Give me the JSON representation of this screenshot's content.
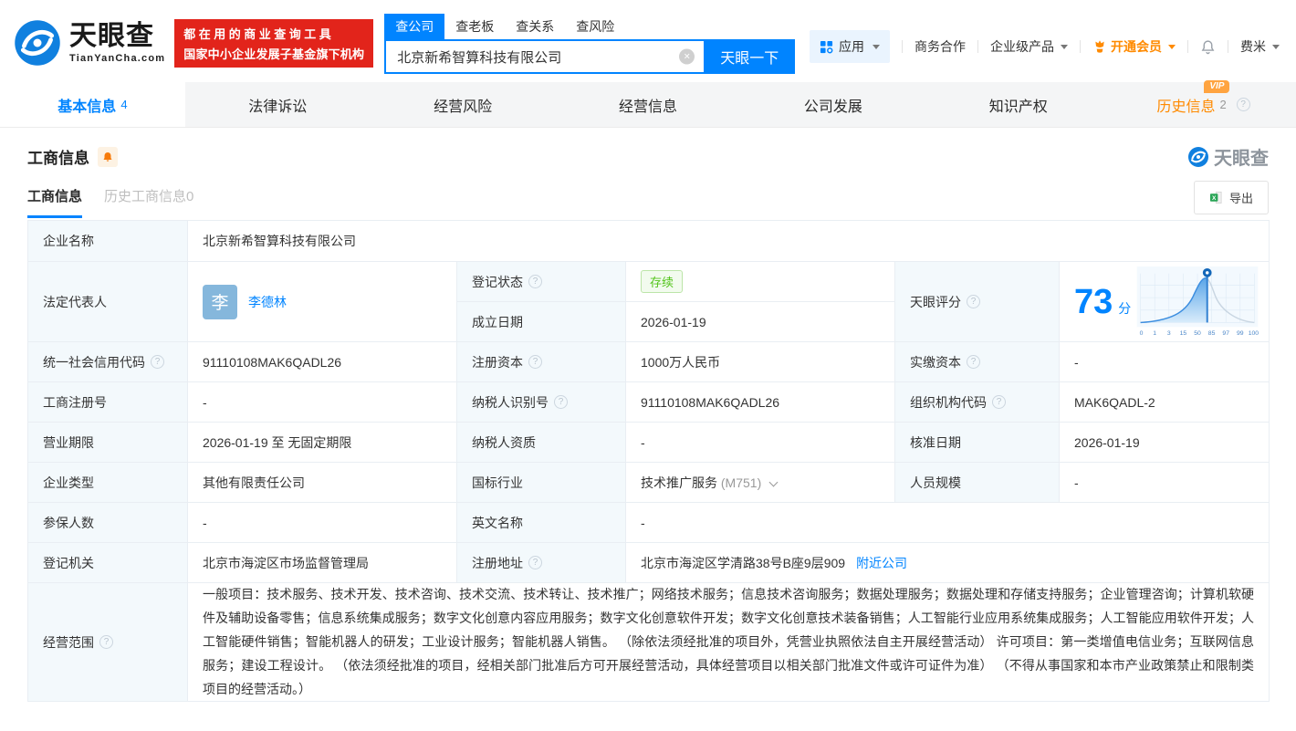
{
  "colors": {
    "accent": "#0084ff",
    "orange": "#ff8a00",
    "red": "#e2241b",
    "green": "#52c41a"
  },
  "header": {
    "brand": "天眼查",
    "brand_domain": "TianYanCha.com",
    "slogan_line1": "都在用的商业查询工具",
    "slogan_line2": "国家中小企业发展子基金旗下机构",
    "search_tabs": [
      "查公司",
      "查老板",
      "查关系",
      "查风险"
    ],
    "search_value": "北京新希智算科技有限公司",
    "search_button": "天眼一下",
    "menu_apps": "应用",
    "menu_cooperation": "商务合作",
    "menu_enterprise": "企业级产品",
    "menu_vip": "开通会员",
    "menu_user": "费米"
  },
  "nav": [
    {
      "label": "基本信息",
      "count": "4"
    },
    {
      "label": "法律诉讼"
    },
    {
      "label": "经营风险"
    },
    {
      "label": "经营信息"
    },
    {
      "label": "公司发展"
    },
    {
      "label": "知识产权"
    },
    {
      "label": "历史信息",
      "count": "2",
      "vip": "VIP"
    }
  ],
  "section": {
    "title": "工商信息",
    "watermark": "天眼查",
    "tab_current": "工商信息",
    "tab_history": "历史工商信息0",
    "export_label": "导出"
  },
  "table": {
    "company_name": {
      "label": "企业名称",
      "value": "北京新希智算科技有限公司"
    },
    "legal_rep": {
      "label": "法定代表人",
      "avatar": "李",
      "value": "李德林"
    },
    "reg_status": {
      "label": "登记状态",
      "value": "存续"
    },
    "establish_date": {
      "label": "成立日期",
      "value": "2026-01-19"
    },
    "score": {
      "label": "天眼评分",
      "value": "73",
      "unit": "分",
      "axis": [
        "0",
        "1",
        "3",
        "15",
        "50",
        "85",
        "97",
        "99",
        "100"
      ]
    },
    "credit_code": {
      "label": "统一社会信用代码",
      "value": "91110108MAK6QADL26"
    },
    "reg_capital": {
      "label": "注册资本",
      "value": "1000万人民币"
    },
    "paid_capital": {
      "label": "实缴资本",
      "value": "-"
    },
    "reg_number": {
      "label": "工商注册号",
      "value": "-"
    },
    "taxpayer_id": {
      "label": "纳税人识别号",
      "value": "91110108MAK6QADL26"
    },
    "org_code": {
      "label": "组织机构代码",
      "value": "MAK6QADL-2"
    },
    "business_term": {
      "label": "营业期限",
      "value": "2026-01-19 至 无固定期限"
    },
    "taxpayer_quality": {
      "label": "纳税人资质",
      "value": "-"
    },
    "approval_date": {
      "label": "核准日期",
      "value": "2026-01-19"
    },
    "company_type": {
      "label": "企业类型",
      "value": "其他有限责任公司"
    },
    "industry": {
      "label": "国标行业",
      "value": "技术推广服务",
      "code": "(M751)"
    },
    "staff_size": {
      "label": "人员规模",
      "value": "-"
    },
    "insured_count": {
      "label": "参保人数",
      "value": "-"
    },
    "english_name": {
      "label": "英文名称",
      "value": "-"
    },
    "reg_authority": {
      "label": "登记机关",
      "value": "北京市海淀区市场监督管理局"
    },
    "reg_address": {
      "label": "注册地址",
      "value": "北京市海淀区学清路38号B座9层909",
      "nearby_link": "附近公司"
    },
    "business_scope": {
      "label": "经营范围",
      "value": "一般项目：技术服务、技术开发、技术咨询、技术交流、技术转让、技术推广；网络技术服务；信息技术咨询服务；数据处理服务；数据处理和存储支持服务；企业管理咨询；计算机软硬件及辅助设备零售；信息系统集成服务；数字文化创意内容应用服务；数字文化创意软件开发；数字文化创意技术装备销售；人工智能行业应用系统集成服务；人工智能应用软件开发；人工智能硬件销售；智能机器人的研发；工业设计服务；智能机器人销售。 （除依法须经批准的项目外，凭营业执照依法自主开展经营活动） 许可项目：第一类增值电信业务；互联网信息服务；建设工程设计。 （依法须经批准的项目，经相关部门批准后方可开展经营活动，具体经营项目以相关部门批准文件或许可证件为准） （不得从事国家和本市产业政策禁止和限制类项目的经营活动。）"
    }
  }
}
